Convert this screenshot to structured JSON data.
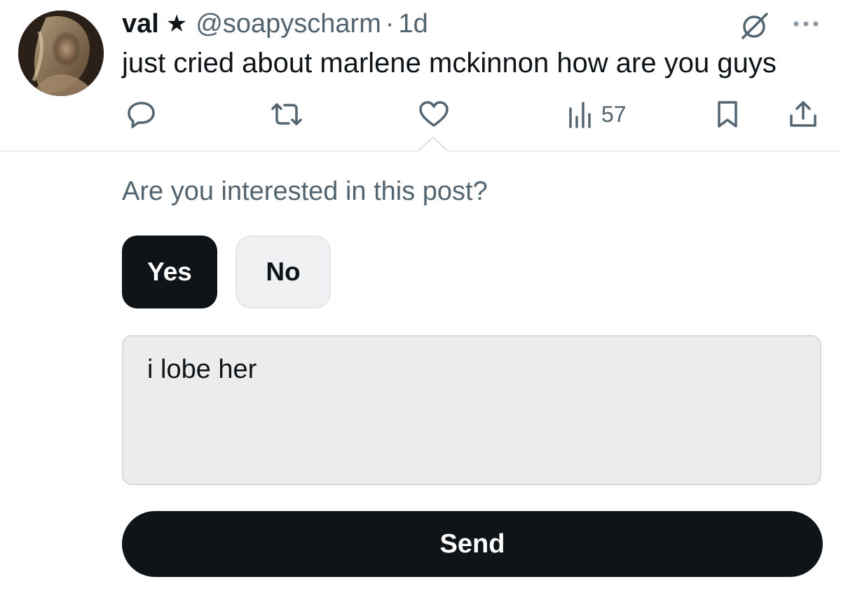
{
  "tweet": {
    "display_name": "val",
    "star": "★",
    "handle": "@soapyscharm",
    "separator": "·",
    "time": "1d",
    "text": "just cried about marlene mckinnon how are you guys",
    "views_count": "57",
    "avatar_icon": "profile-photo",
    "icons": [
      "grok-icon",
      "more-icon",
      "reply-icon",
      "retweet-icon",
      "like-icon",
      "views-icon",
      "bookmark-icon",
      "share-icon"
    ]
  },
  "survey": {
    "question": "Are you interested in this post?",
    "yes_label": "Yes",
    "no_label": "No",
    "selected": "Yes",
    "feedback_value": "i lobe her",
    "send_label": "Send"
  },
  "colors": {
    "text_primary": "#0f1419",
    "text_secondary": "#536471",
    "button_dark": "#0f1419",
    "button_light": "#eff1f2",
    "input_bg": "#ececec",
    "divider": "#cfd9de"
  }
}
